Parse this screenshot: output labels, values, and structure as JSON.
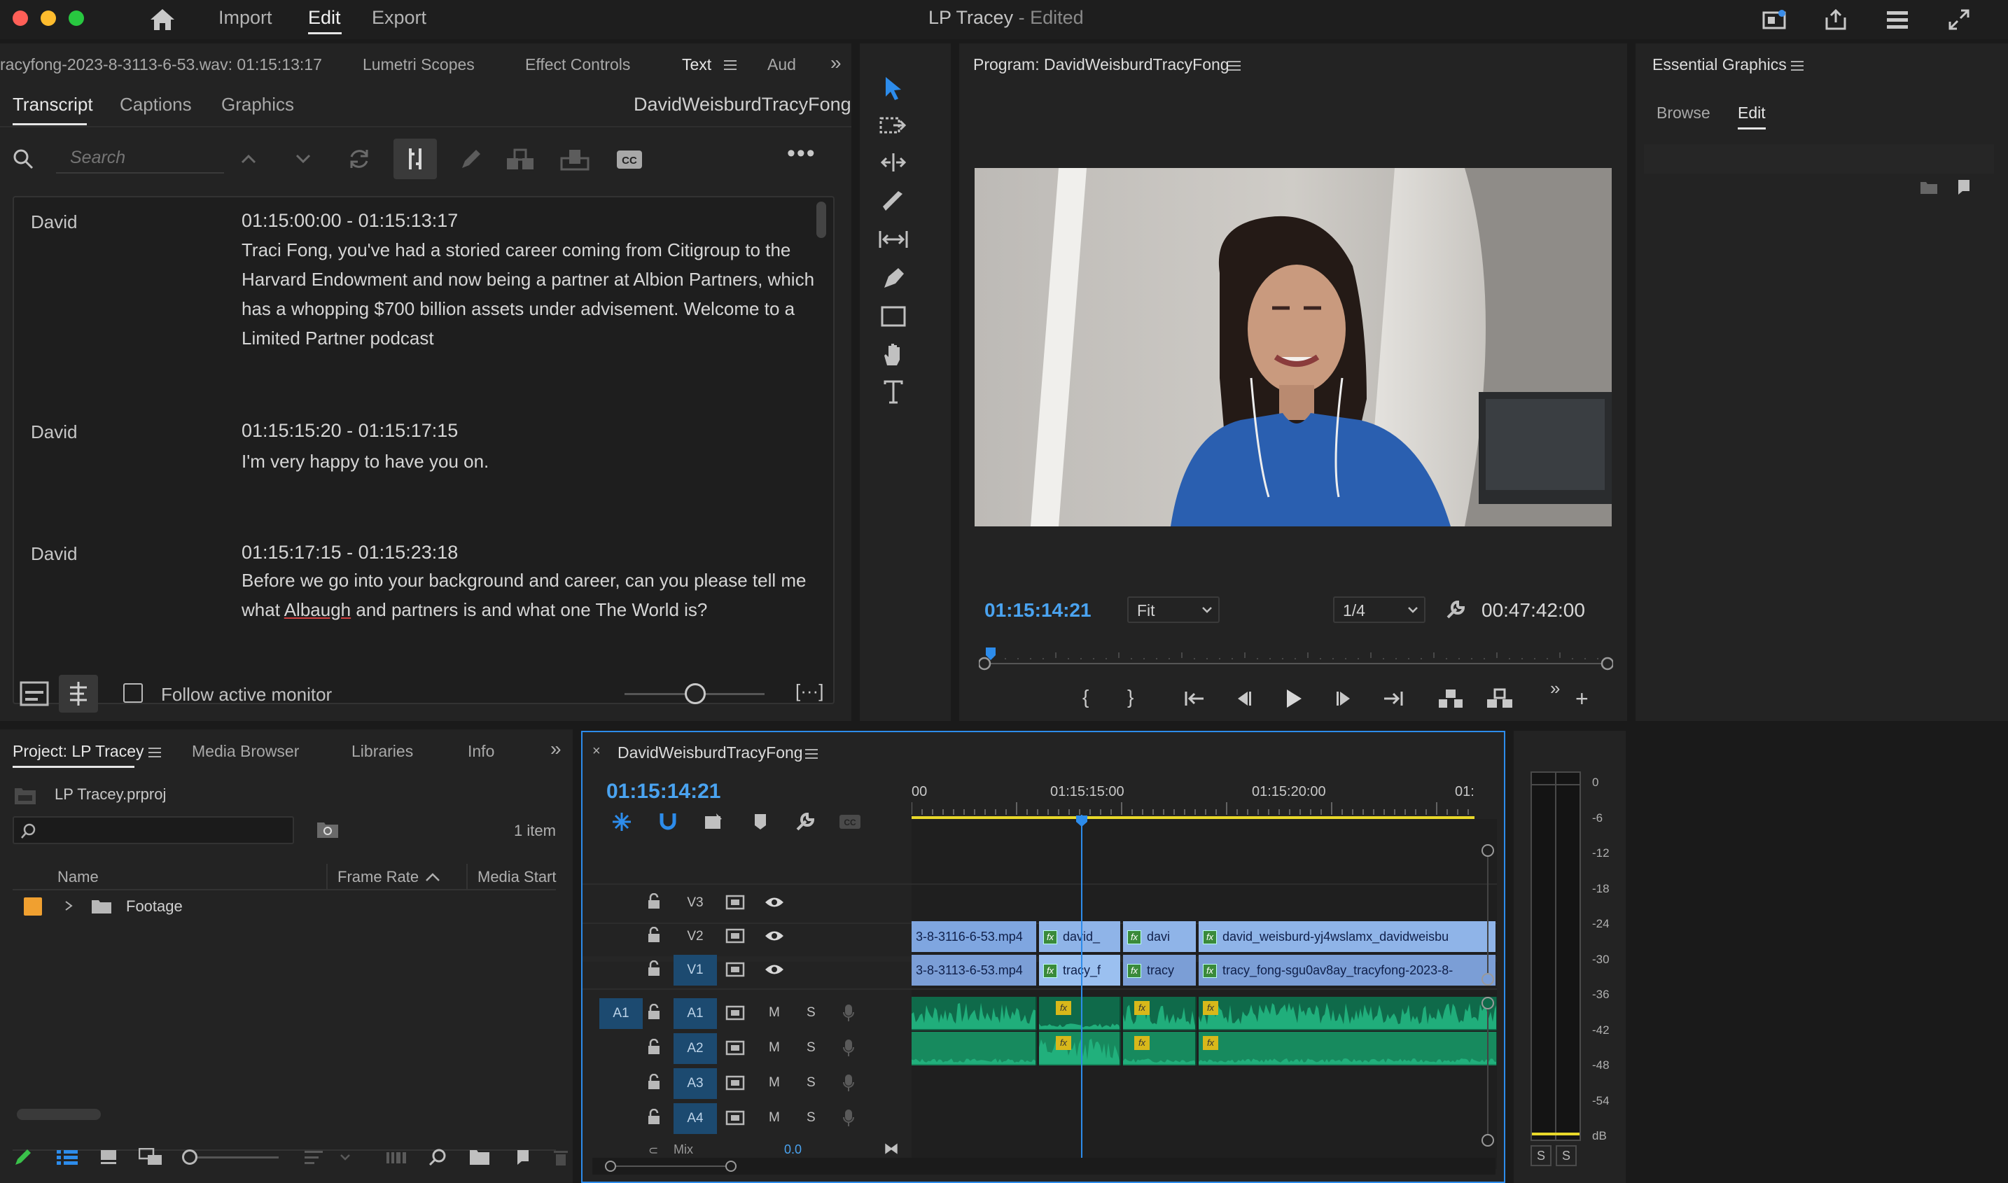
{
  "titlebar": {
    "workspace_tabs": [
      "Import",
      "Edit",
      "Export"
    ],
    "active_tab": "Edit",
    "project_title": "LP Tracey",
    "status": "- Edited"
  },
  "text_panel": {
    "tabs": [
      "racyfong-2023-8-3113-6-53.wav: 01:15:13:17",
      "Lumetri Scopes",
      "Effect Controls",
      "Text",
      "Aud"
    ],
    "subtabs": [
      "Transcript",
      "Captions",
      "Graphics"
    ],
    "sequence_name": "DavidWeisburdTracyFong",
    "search_placeholder": "Search",
    "follow_label": "Follow active monitor",
    "entries": [
      {
        "speaker": "David",
        "timecode": "01:15:00:00 - 01:15:13:17",
        "text": "Traci Fong, you've had a storied career coming from Citigroup to the Harvard Endowment and now being a partner at Albion Partners, which has a whopping $700 billion assets under advisement. Welcome to a Limited Partner podcast"
      },
      {
        "speaker": "David",
        "timecode": "01:15:15:20 - 01:15:17:15",
        "text": "I'm very happy to have you on."
      },
      {
        "speaker": "David",
        "timecode": "01:15:17:15 - 01:15:23:18",
        "text_before": "Before we go into your background and career, can you please tell me what ",
        "text_flagged": "Albaugh",
        "text_after": " and partners is and what one The World is?"
      }
    ]
  },
  "program_monitor": {
    "title": "Program: DavidWeisburdTracyFong",
    "timecode": "01:15:14:21",
    "zoom": "Fit",
    "resolution": "1/4",
    "duration": "00:47:42:00",
    "playhead_fraction": 0.01
  },
  "essential_graphics": {
    "title": "Essential Graphics",
    "tabs": [
      "Browse",
      "Edit"
    ],
    "active_tab": "Edit"
  },
  "project_panel": {
    "tabs": [
      "Project: LP Tracey",
      "Media Browser",
      "Libraries",
      "Info"
    ],
    "file": "LP Tracey.prproj",
    "item_count": "1 item",
    "columns": [
      "Name",
      "Frame Rate",
      "Media Start"
    ],
    "rows": [
      {
        "name": "Footage",
        "color": "#f0a030"
      }
    ]
  },
  "timeline": {
    "sequence": "DavidWeisburdTracyFong",
    "timecode": "01:15:14:21",
    "ruler_labels": [
      "00",
      "01:15:15:00",
      "01:15:20:00",
      "01:"
    ],
    "video_tracks": [
      "V3",
      "V2",
      "V1"
    ],
    "audio_tracks": [
      "A1",
      "A2",
      "A3",
      "A4"
    ],
    "source_patch": "A1",
    "mix_label": "Mix",
    "mix_value": "0.0",
    "v2_clips": [
      "3-8-3116-6-53.mp4",
      "david_",
      "davi",
      "david_weisburd-yj4wslamx_davidweisbu"
    ],
    "v1_clips": [
      "3-8-3113-6-53.mp4",
      "tracy_f",
      "tracy",
      "tracy_fong-sgu0av8ay_tracyfong-2023-8-"
    ],
    "track_buttons": {
      "mute": "M",
      "solo": "S"
    }
  },
  "audio_meter": {
    "scale": [
      "0",
      "-6",
      "-12",
      "-18",
      "-24",
      "-30",
      "-36",
      "-42",
      "-48",
      "-54",
      "dB"
    ],
    "solo_buttons": [
      "S",
      "S"
    ]
  },
  "colors": {
    "accent_blue": "#2d8ceb",
    "clip_video": "#8fb4e8",
    "clip_audio": "#22b27d",
    "timecode": "#4aa3f0",
    "label_orange": "#f0a030"
  }
}
